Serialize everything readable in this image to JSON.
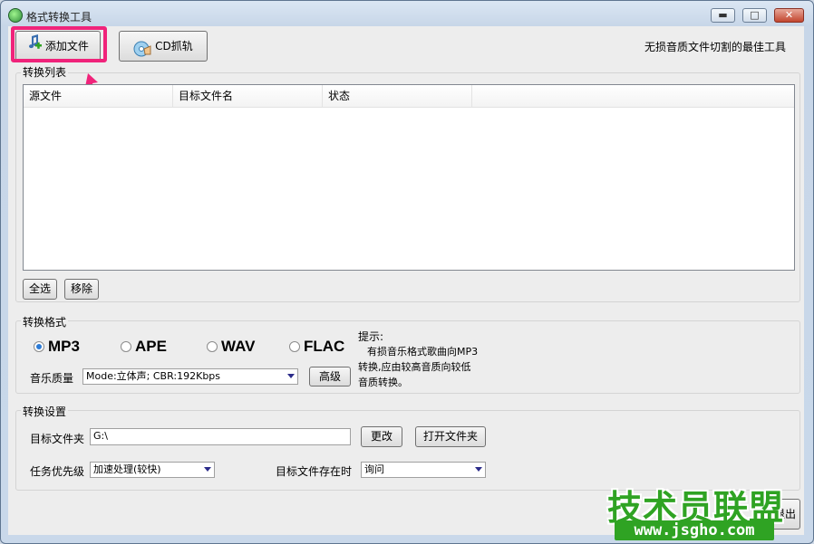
{
  "window": {
    "title": "格式转换工具"
  },
  "titlebar_buttons": {
    "minimize": "▬",
    "maximize": "□",
    "close": "✕"
  },
  "toolbar": {
    "add_file": "添加文件",
    "cd_rip": "CD抓轨",
    "tagline": "无损音质文件切割的最佳工具"
  },
  "conversion_list": {
    "group_label": "转换列表",
    "columns": [
      "源文件",
      "目标文件名",
      "状态"
    ],
    "select_all": "全选",
    "remove": "移除"
  },
  "format": {
    "group_label": "转换格式",
    "options": [
      "MP3",
      "APE",
      "WAV",
      "FLAC"
    ],
    "selected": "MP3",
    "quality_label": "音乐质量",
    "quality_value": "Mode:立体声; CBR:192Kbps",
    "advanced": "高级",
    "hint_title": "提示:",
    "hint_lines": [
      "有损音乐格式歌曲向MP3",
      "转换,应由较高音质向较低",
      "音质转换。"
    ]
  },
  "settings": {
    "group_label": "转换设置",
    "target_folder_label": "目标文件夹",
    "target_folder_value": "G:\\",
    "change": "更改",
    "open_folder": "打开文件夹",
    "priority_label": "任务优先级",
    "priority_value": "加速处理(较快)",
    "exists_label": "目标文件存在时",
    "exists_value": "询问"
  },
  "exit_button": "退出",
  "watermark": {
    "brand": "技术员联盟",
    "url": "www.jsgho.com"
  },
  "colors": {
    "highlight": "#f0237a",
    "radio_selected": "#2c7bd6",
    "watermark": "#2fa323"
  }
}
